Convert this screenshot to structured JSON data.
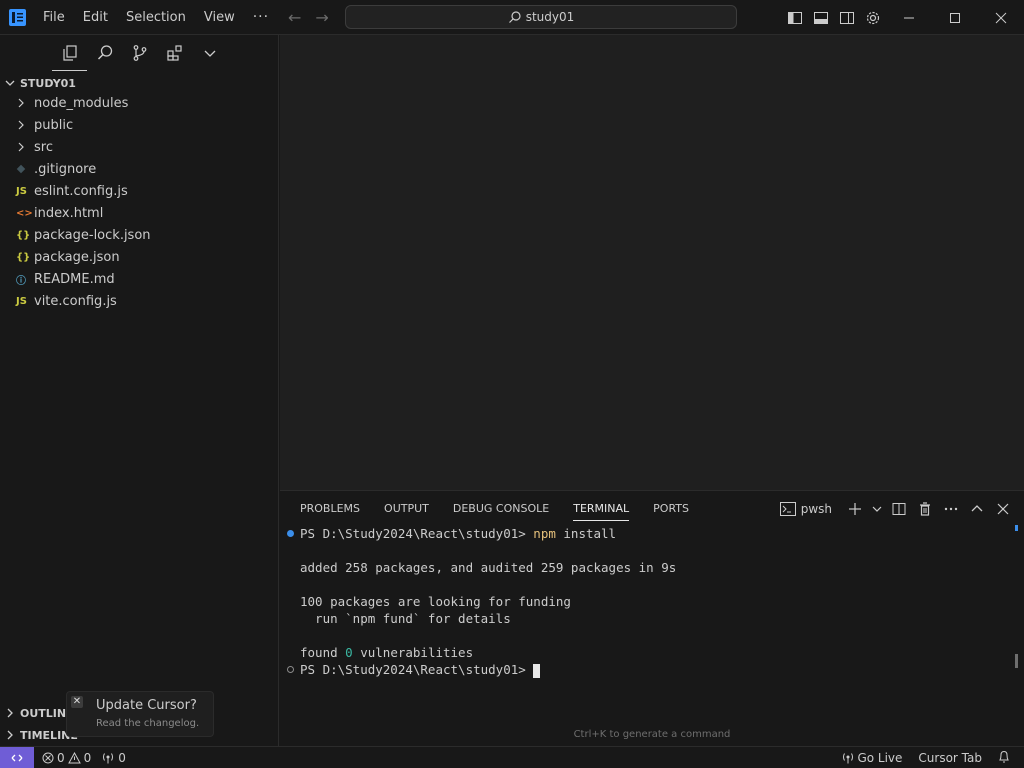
{
  "titlebar": {
    "menu": [
      "File",
      "Edit",
      "Selection",
      "View"
    ],
    "more": "···",
    "search_text": "study01",
    "icons": [
      "toggle-primary-sidebar-icon",
      "toggle-panel-icon",
      "toggle-secondary-sidebar-icon",
      "settings-gear-icon"
    ],
    "window_controls": [
      "minimize-icon",
      "maximize-icon",
      "close-icon"
    ]
  },
  "sidebar": {
    "tabs": [
      "explorer-icon",
      "search-icon",
      "source-control-icon",
      "extensions-icon",
      "chevron-down-icon"
    ],
    "explorer_title": "STUDY01",
    "tree": [
      {
        "label": "node_modules",
        "kind": "folder"
      },
      {
        "label": "public",
        "kind": "folder"
      },
      {
        "label": "src",
        "kind": "folder"
      },
      {
        "label": ".gitignore",
        "kind": "git"
      },
      {
        "label": "eslint.config.js",
        "kind": "js",
        "icon_text": "JS"
      },
      {
        "label": "index.html",
        "kind": "html",
        "icon_text": "<>"
      },
      {
        "label": "package-lock.json",
        "kind": "json",
        "icon_text": "{}"
      },
      {
        "label": "package.json",
        "kind": "json",
        "icon_text": "{}"
      },
      {
        "label": "README.md",
        "kind": "info",
        "icon_text": "ⓘ"
      },
      {
        "label": "vite.config.js",
        "kind": "js",
        "icon_text": "JS"
      }
    ],
    "sections": [
      "OUTLINE",
      "TIMELINE"
    ]
  },
  "update_toast": {
    "close": "✕",
    "title": "Update Cursor?",
    "subtitle": "Read the changelog."
  },
  "panel": {
    "tabs": [
      "PROBLEMS",
      "OUTPUT",
      "DEBUG CONSOLE",
      "TERMINAL",
      "PORTS"
    ],
    "active_tab": "TERMINAL",
    "shell": "pwsh",
    "terminal": {
      "prompt": "PS D:\\Study2024\\React\\study01> ",
      "command": "npm",
      "command_args": " install",
      "line_added": "added 258 packages, and audited 259 packages in 9s",
      "line_funding": "100 packages are looking for funding",
      "line_fund_cmd": "  run `npm fund` for details",
      "line_found_pre": "found ",
      "line_found_num": "0",
      "line_found_post": " vulnerabilities",
      "prompt2": "PS D:\\Study2024\\React\\study01> "
    },
    "hint": "Ctrl+K to generate a command"
  },
  "statusbar": {
    "errors": "0",
    "warnings": "0",
    "ports": "0",
    "go_live": "Go Live",
    "cursor_tab": "Cursor Tab"
  },
  "colors": {
    "accent": "#6f5dd6",
    "terminal_command": "#e5c07b",
    "terminal_number": "#3bb8a3",
    "js_icon": "#cbcb41",
    "html_icon": "#e37933",
    "info_icon": "#519aba"
  }
}
